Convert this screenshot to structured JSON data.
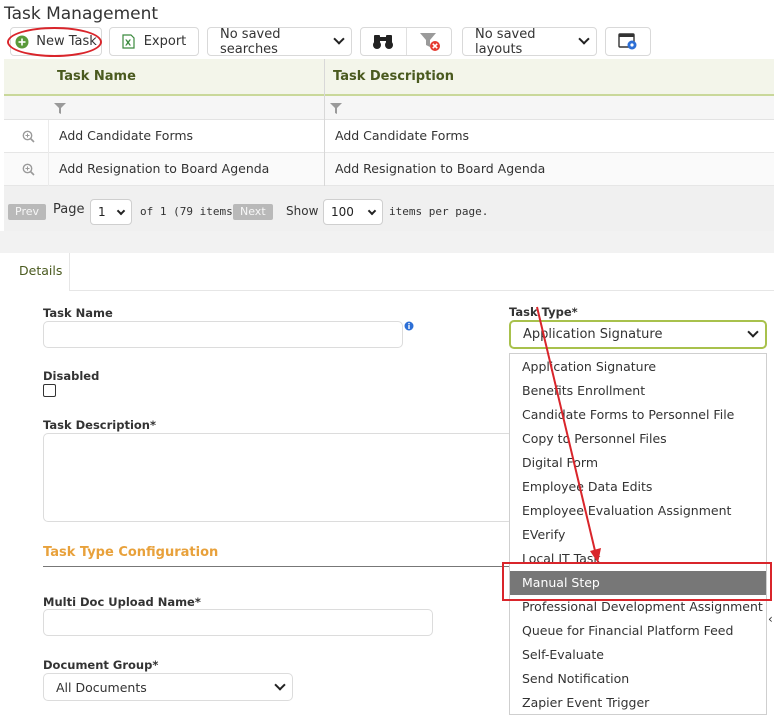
{
  "page_title": "Task Management",
  "toolbar": {
    "new_task_label": "New Task",
    "export_label": "Export",
    "saved_searches_value": "No saved searches",
    "saved_layouts_value": "No saved layouts",
    "icons": [
      "plus-circle-icon",
      "excel-icon",
      "binoculars-icon",
      "clear-filter-icon",
      "layout-settings-icon"
    ]
  },
  "grid": {
    "columns": [
      "Task Name",
      "Task Description"
    ],
    "rows": [
      {
        "name": "Add Candidate Forms",
        "description": "Add Candidate Forms"
      },
      {
        "name": "Add Resignation to Board Agenda",
        "description": "Add Resignation to Board Agenda"
      }
    ]
  },
  "pager": {
    "prev_label": "Prev",
    "page_label": "Page",
    "page_value": "1",
    "of_text": "of 1 (79 items)",
    "next_label": "Next",
    "show_label": "Show",
    "per_page_value": "100",
    "per_page_suffix": "items per page."
  },
  "details": {
    "tab_label": "Details",
    "task_name_label": "Task Name",
    "disabled_label": "Disabled",
    "task_description_label": "Task Description*",
    "section_title": "Task Type Configuration",
    "multi_doc_label": "Multi Doc Upload Name*",
    "document_group_label": "Document Group*",
    "document_group_value": "All Documents",
    "task_type_label": "Task Type*",
    "task_type_value": "Application Signature"
  },
  "task_type_options": [
    "Application Signature",
    "Benefits Enrollment",
    "Candidate Forms to Personnel File",
    "Copy to Personnel Files",
    "Digital Form",
    "Employee Data Edits",
    "Employee Evaluation Assignment",
    "EVerify",
    "Local IT Task",
    "Manual Step",
    "Professional Development Assignment",
    "Queue for Financial Platform Feed",
    "Self-Evaluate",
    "Send Notification",
    "Zapier Event Trigger"
  ],
  "highlighted_option": "Manual Step",
  "colors": {
    "accent_green": "#4a5a1f",
    "focus_green": "#a8c14c",
    "section_orange": "#e8a13b",
    "annotation_red": "#d9252b",
    "selected_gray": "#777777"
  }
}
